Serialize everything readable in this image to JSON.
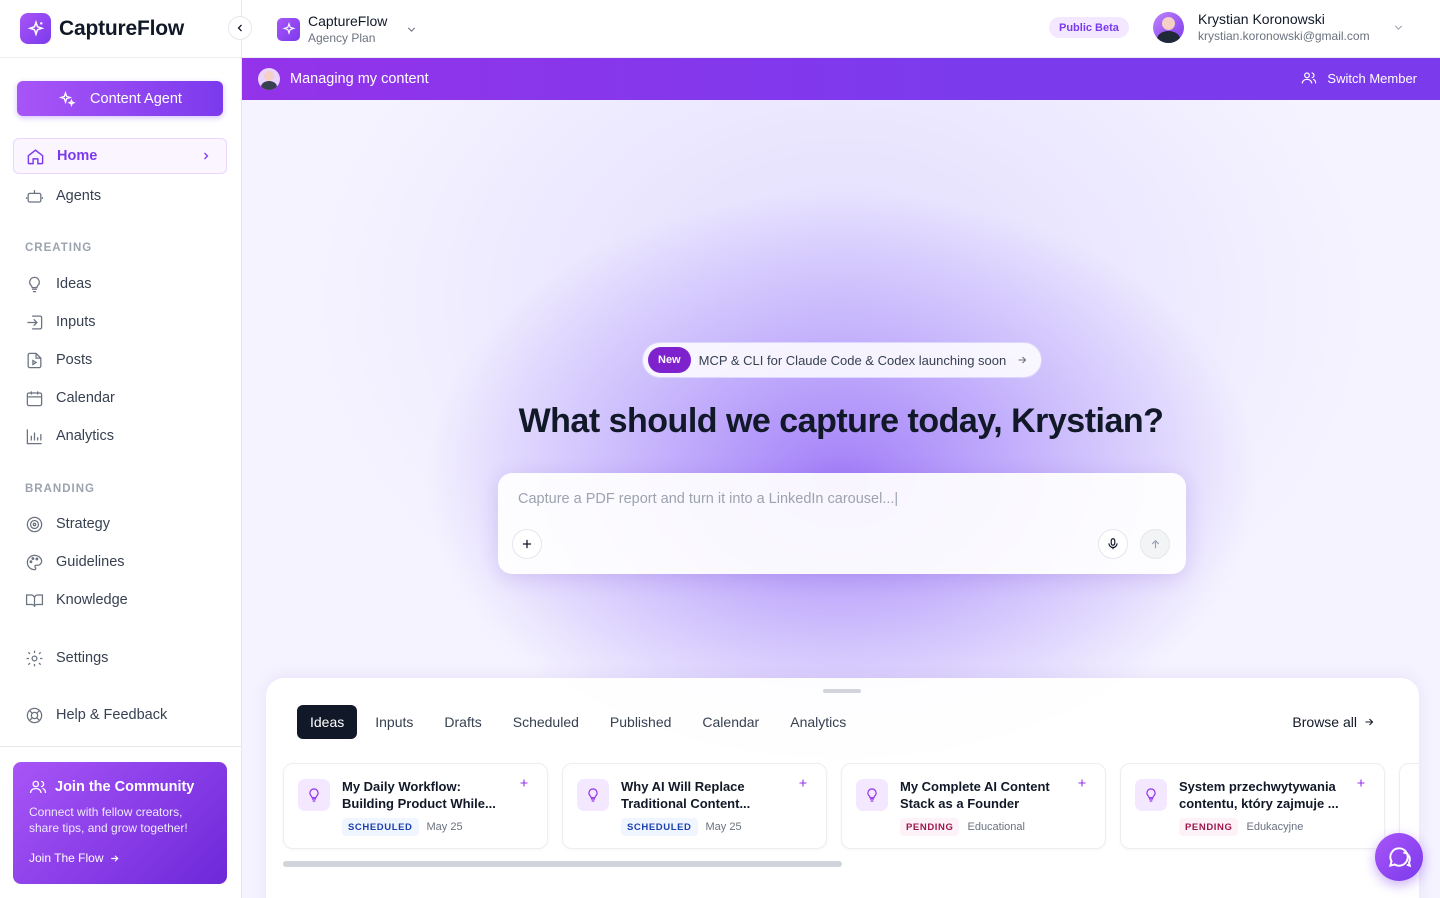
{
  "app": {
    "name": "CaptureFlow"
  },
  "sidebar": {
    "agent_button": "Content Agent",
    "nav": [
      {
        "label": "Home"
      },
      {
        "label": "Agents"
      }
    ],
    "sections": {
      "creating": "CREATING",
      "branding": "BRANDING"
    },
    "creating_items": [
      {
        "label": "Ideas"
      },
      {
        "label": "Inputs"
      },
      {
        "label": "Posts"
      },
      {
        "label": "Calendar"
      },
      {
        "label": "Analytics"
      }
    ],
    "branding_items": [
      {
        "label": "Strategy"
      },
      {
        "label": "Guidelines"
      },
      {
        "label": "Knowledge"
      }
    ],
    "settings": "Settings",
    "help": "Help & Feedback",
    "community": {
      "title": "Join the Community",
      "description": "Connect with fellow creators, share tips, and grow together!",
      "link": "Join The Flow"
    }
  },
  "topbar": {
    "workspace_name": "CaptureFlow",
    "workspace_plan": "Agency Plan",
    "beta_badge": "Public Beta",
    "user_name": "Krystian Koronowski",
    "user_email": "krystian.koronowski@gmail.com"
  },
  "banner": {
    "text": "Managing my content",
    "switch_label": "Switch Member"
  },
  "hero": {
    "pill_badge": "New",
    "pill_text": "MCP & CLI for Claude Code & Codex launching soon",
    "headline": "What should we capture today, Krystian?",
    "composer_placeholder": "Capture a PDF report and turn it into a LinkedIn carousel...|"
  },
  "panel": {
    "tabs": [
      {
        "label": "Ideas",
        "active": true
      },
      {
        "label": "Inputs"
      },
      {
        "label": "Drafts"
      },
      {
        "label": "Scheduled"
      },
      {
        "label": "Published"
      },
      {
        "label": "Calendar"
      },
      {
        "label": "Analytics"
      }
    ],
    "browse_all": "Browse all",
    "cards": [
      {
        "line1": "My Daily Workflow:",
        "line2": "Building Product While...",
        "status": "SCHEDULED",
        "meta": "May 25"
      },
      {
        "line1": "Why AI Will Replace",
        "line2": "Traditional Content...",
        "status": "SCHEDULED",
        "meta": "May 25"
      },
      {
        "line1": "My Complete AI Content",
        "line2": "Stack as a Founder",
        "status": "PENDING",
        "meta": "Educational"
      },
      {
        "line1": "System przechwytywania",
        "line2": "contentu, który zajmuje ...",
        "status": "PENDING",
        "meta": "Edukacyjne"
      }
    ]
  },
  "colors": {
    "accent": "#7c3aed",
    "accent_light": "#a855f7"
  }
}
